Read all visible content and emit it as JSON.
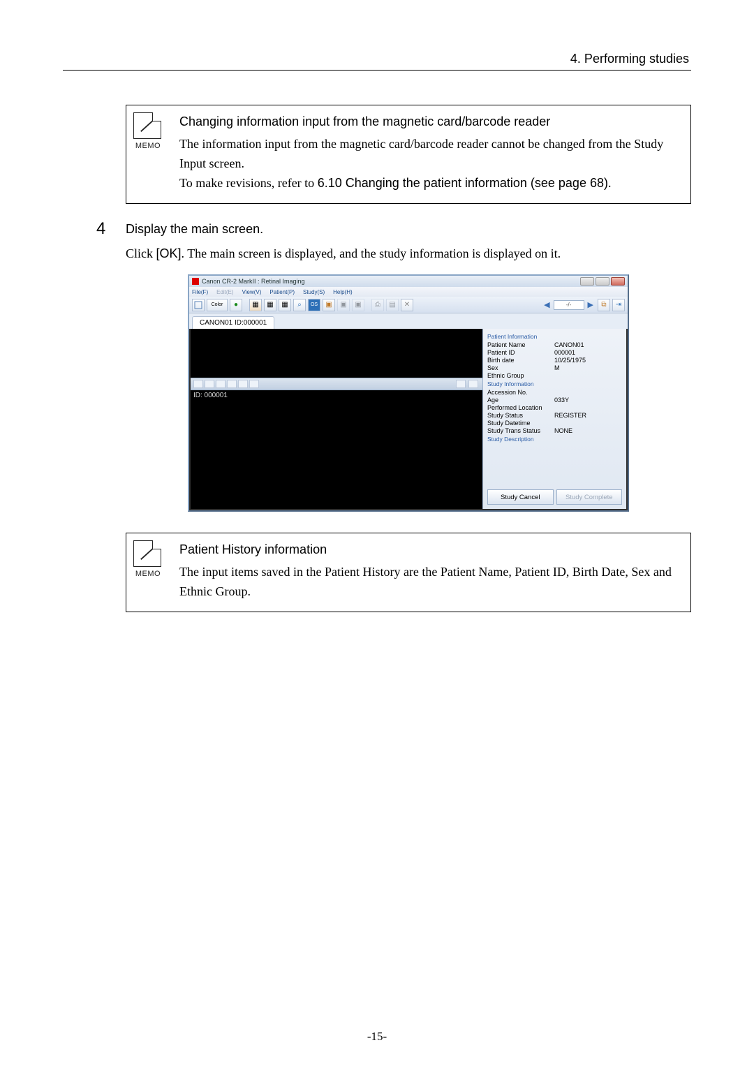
{
  "chapter": "4. Performing studies",
  "memo1": {
    "title": "Changing information input from the magnetic card/barcode reader",
    "line1": "The information input from the magnetic card/barcode reader cannot be changed from the Study Input screen.",
    "line2a": "To make revisions, refer to ",
    "line2b": "6.10 Changing the patient information (see page 68)",
    "line2c": "."
  },
  "step": {
    "number": "4",
    "title": "Display the main screen.",
    "body_pre": "Click ",
    "body_ok": "[OK]",
    "body_post": ". The main screen is displayed, and the study information is displayed on it."
  },
  "memo2": {
    "title": "Patient History information",
    "body_pre": "The input items saved in the Patient History are the ",
    "b1": "Patient Name",
    "s1": ", ",
    "b2": "Patient ID",
    "s2": ", ",
    "b3": "Birth Date",
    "s3": ", ",
    "b4": "Sex",
    "body_mid": " and ",
    "b5": "Ethnic Group",
    "body_post": "."
  },
  "page_number": "-15-",
  "memo_icon_caption": "MEMO",
  "app": {
    "title": "Canon CR-2 MarkII : Retinal Imaging",
    "menu": {
      "file": "File(F)",
      "edit": "Edit(E)",
      "view": "View(V)",
      "patient": "Patient(P)",
      "study": "Study(S)",
      "help": "Help(H)"
    },
    "tab": "CANON01 ID:000001",
    "id_label": "ID: 000001",
    "pager": "-/-",
    "color_btn": "Color",
    "groups": {
      "patient_info_title": "Patient Information",
      "study_info_title": "Study Information",
      "study_desc_title": "Study Description"
    },
    "patient": {
      "name_k": "Patient Name",
      "name_v": "CANON01",
      "id_k": "Patient ID",
      "id_v": "000001",
      "birth_k": "Birth date",
      "birth_v": "10/25/1975",
      "sex_k": "Sex",
      "sex_v": "M",
      "ethnic_k": "Ethnic Group",
      "ethnic_v": ""
    },
    "study": {
      "acc_k": "Accession No.",
      "acc_v": "",
      "age_k": "Age",
      "age_v": "033Y",
      "loc_k": "Performed Location",
      "loc_v": "",
      "status_k": "Study Status",
      "status_v": "REGISTER",
      "dt_k": "Study Datetime",
      "dt_v": "",
      "trans_k": "Study Trans Status",
      "trans_v": "NONE"
    },
    "buttons": {
      "cancel": "Study Cancel",
      "complete": "Study Complete"
    }
  }
}
